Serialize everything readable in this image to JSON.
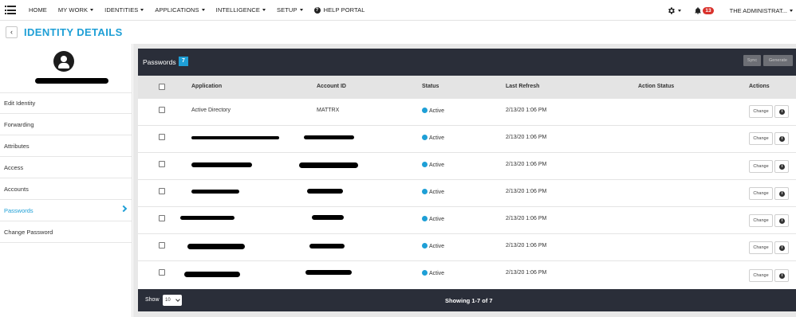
{
  "nav": {
    "items": [
      {
        "label": "HOME",
        "caret": false
      },
      {
        "label": "MY WORK",
        "caret": true
      },
      {
        "label": "IDENTITIES",
        "caret": true
      },
      {
        "label": "APPLICATIONS",
        "caret": true
      },
      {
        "label": "INTELLIGENCE",
        "caret": true
      },
      {
        "label": "SETUP",
        "caret": true
      }
    ],
    "help_label": "HELP PORTAL",
    "notification_count": "13",
    "user_label": "THE ADMINISTRAT..."
  },
  "page": {
    "title": "IDENTITY DETAILS"
  },
  "sidebar": {
    "items": [
      {
        "label": "Edit Identity"
      },
      {
        "label": "Forwarding"
      },
      {
        "label": "Attributes"
      },
      {
        "label": "Access"
      },
      {
        "label": "Accounts"
      },
      {
        "label": "Passwords"
      },
      {
        "label": "Change Password"
      }
    ],
    "active_index": 5
  },
  "panel": {
    "title": "Passwords",
    "count": "7",
    "sync_label": "Sync",
    "generate_label": "Generate",
    "columns": [
      "Application",
      "Account ID",
      "Status",
      "Last Refresh",
      "Action Status",
      "Actions"
    ],
    "rows": [
      {
        "application": "Active Directory",
        "account_id": "MATTRX",
        "status": "Active",
        "last_refresh": "2/13/20 1:06 PM"
      },
      {
        "application": "",
        "account_id": "",
        "status": "Active",
        "last_refresh": "2/13/20 1:06 PM"
      },
      {
        "application": "",
        "account_id": "",
        "status": "Active",
        "last_refresh": "2/13/20 1:06 PM"
      },
      {
        "application": "",
        "account_id": "",
        "status": "Active",
        "last_refresh": "2/13/20 1:06 PM"
      },
      {
        "application": "",
        "account_id": "",
        "status": "Active",
        "last_refresh": "2/13/20 1:06 PM"
      },
      {
        "application": "",
        "account_id": "",
        "status": "Active",
        "last_refresh": "2/13/20 1:06 PM"
      },
      {
        "application": "",
        "account_id": "",
        "status": "Active",
        "last_refresh": "2/13/20 1:06 PM"
      }
    ],
    "change_label": "Change",
    "show_label": "Show",
    "page_size": "10",
    "showing_text": "Showing 1-7 of 7"
  },
  "colors": {
    "accent": "#1e9fd6",
    "header_dark": "#2a2e39",
    "badge_red": "#d9312b"
  },
  "icons": [
    "hamburger-icon",
    "help-icon",
    "gear-icon",
    "bell-icon",
    "back-icon",
    "avatar-icon",
    "chevron-right-icon",
    "info-icon"
  ]
}
